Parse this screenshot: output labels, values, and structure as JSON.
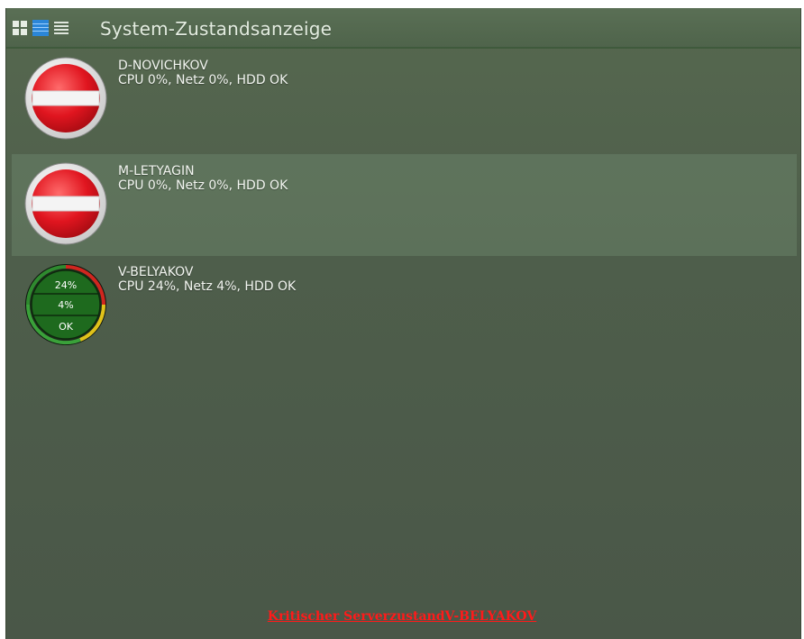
{
  "header": {
    "title": "System-Zustandsanzeige",
    "view_icons": [
      "grid-view-icon",
      "tile-view-icon",
      "list-view-icon"
    ]
  },
  "servers": [
    {
      "name": "D-NOVICHKOV",
      "stats": "CPU 0%, Netz 0%, HDD OK",
      "state": "offline",
      "icon": "no-entry-icon"
    },
    {
      "name": "M-LETYAGIN",
      "stats": "CPU 0%, Netz 0%, HDD OK",
      "state": "offline",
      "icon": "no-entry-icon"
    },
    {
      "name": "V-BELYAKOV",
      "stats": "CPU 24%, Netz 4%, HDD OK",
      "state": "online",
      "icon": "status-gauge-icon",
      "gauge": {
        "cpu": "24%",
        "net": "4%",
        "hdd": "OK"
      }
    }
  ],
  "footer": {
    "status": "Kritischer ServerzustandV-BELYAKOV"
  },
  "colors": {
    "panel": "#4e5e4b",
    "accent_blue": "#2b86d8",
    "alert_red": "#ff1a1a",
    "stop_red": "#d9121c"
  }
}
